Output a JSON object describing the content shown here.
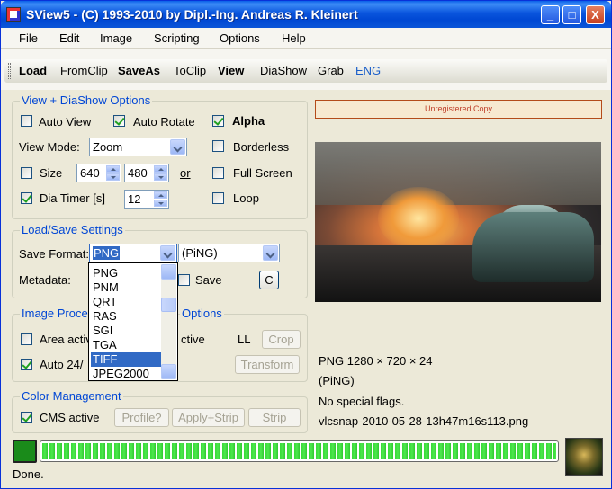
{
  "window": {
    "title": "SView5 - (C) 1993-2010 by Dipl.-Ing. Andreas R. Kleinert",
    "minimize": "_",
    "maximize": "□",
    "close": "X"
  },
  "menu": [
    "File",
    "Edit",
    "Image",
    "Scripting",
    "Options",
    "Help"
  ],
  "toolbar": [
    "Load",
    "FromClip",
    "SaveAs",
    "ToClip",
    "View",
    "DiaShow",
    "Grab",
    "ENG"
  ],
  "view_options": {
    "title": "View + DiaShow Options",
    "auto_view": {
      "label": "Auto View",
      "checked": false
    },
    "auto_rotate": {
      "label": "Auto Rotate",
      "checked": true
    },
    "alpha": {
      "label": "Alpha",
      "checked": true
    },
    "view_mode_label": "View Mode:",
    "view_mode_value": "Zoom",
    "borderless": {
      "label": "Borderless",
      "checked": false
    },
    "size": {
      "label": "Size",
      "checked": false
    },
    "width": "640",
    "height": "480",
    "or": "or",
    "full_screen": {
      "label": "Full Screen",
      "checked": false
    },
    "dia_timer": {
      "label": "Dia Timer [s]",
      "checked": true
    },
    "dia_timer_value": "12",
    "loop": {
      "label": "Loop",
      "checked": false
    }
  },
  "load_save": {
    "title": "Load/Save Settings",
    "save_format_label": "Save Format:",
    "save_format_value": "PNG",
    "format_desc_value": "(PiNG)",
    "metadata_label": "Metadata:",
    "save": {
      "label": "Save",
      "checked": false
    },
    "c_button": "C",
    "dropdown_items": [
      "PNG",
      "PNM",
      "QRT",
      "RAS",
      "SGI",
      "TGA",
      "TIFF",
      "JPEG2000"
    ],
    "dropdown_selected": "TIFF"
  },
  "image_processing": {
    "title_left": "Image Proce",
    "title_right": "Options",
    "area_active_left": "Area activ",
    "area_active_right": "ctive",
    "ll_label": "LL",
    "crop_button": "Crop",
    "auto_left": "Auto 24/",
    "transform_button": "Transform"
  },
  "color_management": {
    "title": "Color Management",
    "cms_active": {
      "label": "CMS active",
      "checked": true
    },
    "profile_button": "Profile?",
    "apply_strip_button": "Apply+Strip",
    "strip_button": "Strip"
  },
  "right_panel": {
    "unregistered": "Unregistered Copy",
    "info_format": "PNG 1280 × 720 × 24",
    "info_desc": "(PiNG)",
    "info_flags": "No special flags.",
    "info_filename": "vlcsnap-2010-05-28-13h47m16s113.png"
  },
  "progress": {
    "value": 1.0
  },
  "status": "Done.",
  "colors": {
    "title_blue": "#0054e3",
    "group_title": "#0046d5",
    "progress_green": "#3cd63c"
  }
}
